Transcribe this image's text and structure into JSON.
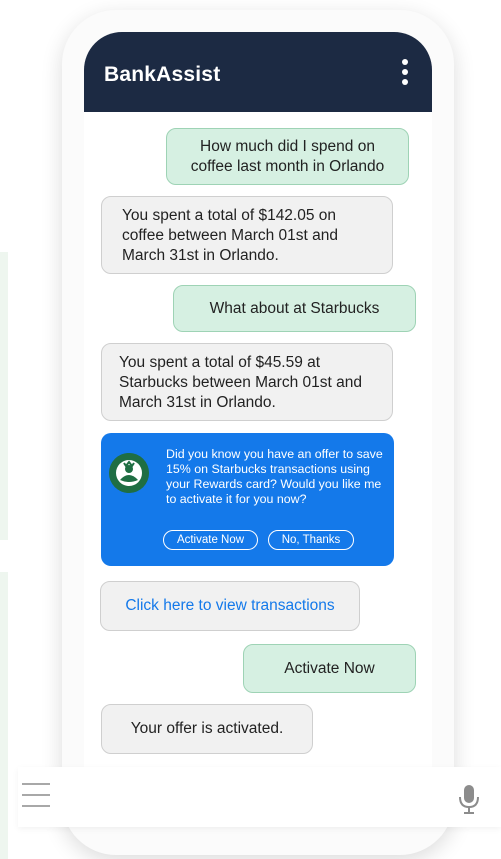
{
  "header": {
    "title": "BankAssist",
    "menu_icon": "kebab-menu-icon"
  },
  "messages": [
    {
      "sender": "user",
      "text": "How much did I spend on coffee last month in Orlando"
    },
    {
      "sender": "bot",
      "text": "You spent a total of $142.05 on coffee between March 01st and March 31st in Orlando."
    },
    {
      "sender": "user",
      "text": "What about at Starbucks"
    },
    {
      "sender": "bot",
      "text": "You spent a total of $45.59 at Starbucks between March 01st and March 31st in Orlando."
    }
  ],
  "offer": {
    "logo_icon": "starbucks-logo",
    "text": "Did you know you have an offer to save 15% on Starbucks transactions using your Rewards card? Would you like me to activate it for you now?",
    "activate_label": "Activate Now",
    "decline_label": "No, Thanks"
  },
  "link": {
    "text": "Click here to view transactions"
  },
  "messages_after": [
    {
      "sender": "user",
      "text": "Activate Now"
    },
    {
      "sender": "bot",
      "text": "Your offer is activated."
    }
  ],
  "bottom_bar": {
    "menu_icon": "hamburger-menu-icon",
    "mic_icon": "microphone-icon"
  },
  "colors": {
    "header": "#1c2a43",
    "user_bubble": "#d6f0e2",
    "bot_bubble": "#f1f1f1",
    "accent": "#1479ea"
  }
}
